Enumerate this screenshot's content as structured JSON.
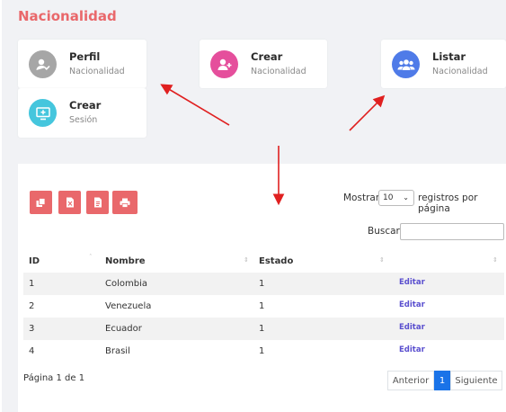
{
  "page_title": "Nacionalidad",
  "cards": [
    {
      "title": "Perfil",
      "subtitle": "Nacionalidad",
      "icon": "user-check-icon",
      "color": "#a6a6a6"
    },
    {
      "title": "Crear",
      "subtitle": "Nacionalidad",
      "icon": "user-plus-icon",
      "color": "#e54f9c"
    },
    {
      "title": "Listar",
      "subtitle": "Nacionalidad",
      "icon": "users-icon",
      "color": "#4f7be8"
    },
    {
      "title": "Crear",
      "subtitle": "Sesión",
      "icon": "monitor-plus-icon",
      "color": "#45c6dd"
    }
  ],
  "table_controls": {
    "show_label": "Mostrar",
    "page_size": "10",
    "per_page_label": "registros por página",
    "search_label": "Buscar",
    "search_value": "",
    "export_buttons": [
      "copy-icon",
      "excel-icon",
      "pdf-icon",
      "print-icon"
    ],
    "export_color": "#e9686b"
  },
  "table": {
    "columns": [
      "ID",
      "Nombre",
      "Estado",
      ""
    ],
    "rows": [
      {
        "id": "1",
        "nombre": "Colombia",
        "estado": "1",
        "action": "Editar"
      },
      {
        "id": "2",
        "nombre": "Venezuela",
        "estado": "1",
        "action": "Editar"
      },
      {
        "id": "3",
        "nombre": "Ecuador",
        "estado": "1",
        "action": "Editar"
      },
      {
        "id": "4",
        "nombre": "Brasil",
        "estado": "1",
        "action": "Editar"
      }
    ]
  },
  "pagination": {
    "info": "Página 1 de 1",
    "previous": "Anterior",
    "current": "1",
    "next": "Siguiente"
  },
  "colors": {
    "accent": "#e9686b",
    "arrow": "#e02020",
    "link": "#5a4fcf",
    "active_page": "#1a73e8"
  }
}
